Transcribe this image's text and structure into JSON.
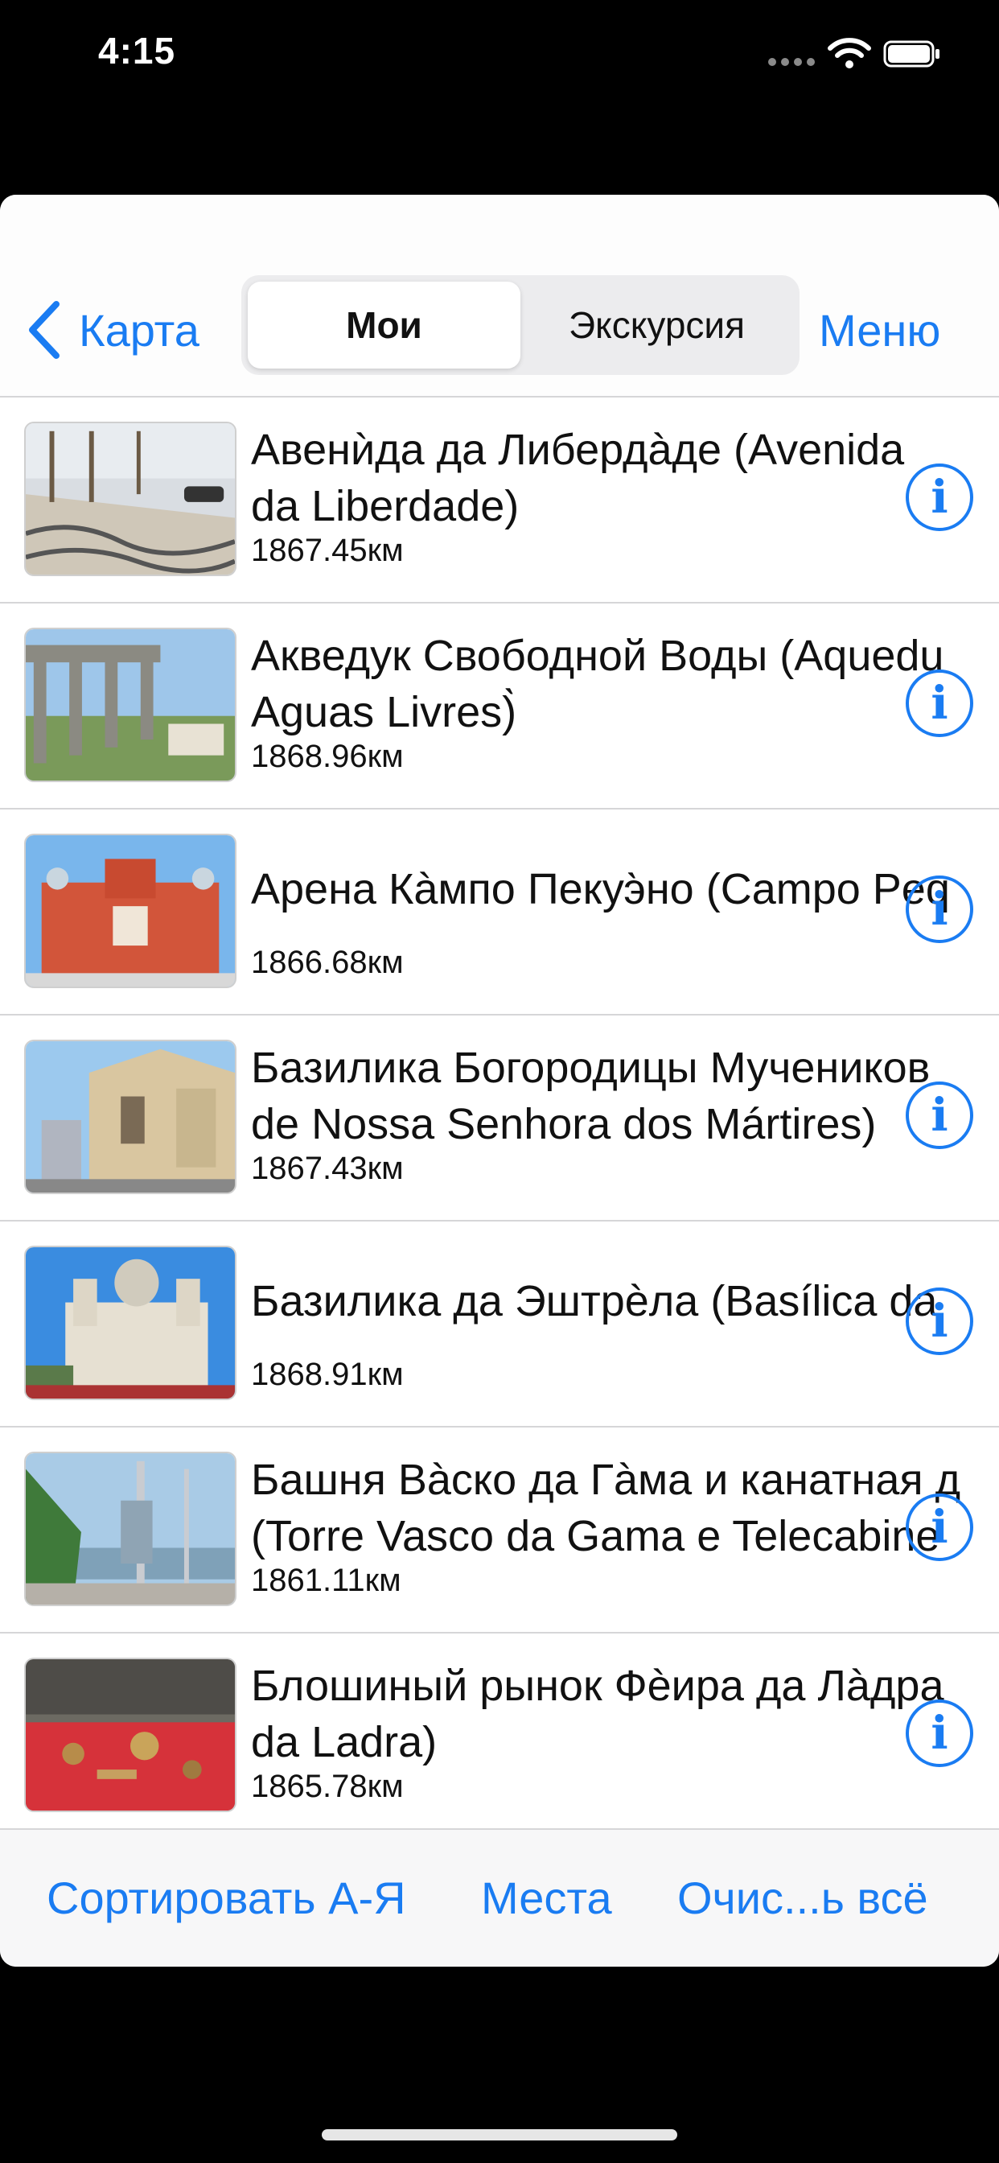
{
  "status_bar": {
    "time": "4:15"
  },
  "nav": {
    "back_label": "Карта",
    "segments": [
      {
        "label": "Мои",
        "selected": true
      },
      {
        "label": "Экскурсия",
        "selected": false
      }
    ],
    "menu_label": "Меню"
  },
  "places": [
    {
      "title_line1": "Авенѝда да Либердàде (Avenida",
      "title_line2": "da Liberdade)",
      "distance": "1867.45км"
    },
    {
      "title_line1": "Акведук Свободной Воды (Aquedu",
      "title_line2": "Aguas Livres)̀",
      "distance": "1868.96км"
    },
    {
      "title_line1": "Арена Кàмпо Пекуэ̀но (Campo Peq",
      "title_line2": "",
      "distance": "1866.68км"
    },
    {
      "title_line1": "Базилика Богородицы Мучеников",
      "title_line2": "de Nossa Senhora dos Mártires)",
      "distance": "1867.43км"
    },
    {
      "title_line1": "Базилика да Эштрѐла (Basílica da",
      "title_line2": "",
      "distance": "1868.91км"
    },
    {
      "title_line1": "Башня Вàско да Гàма и канатная д",
      "title_line2": "(Torre Vasco da Gama e Telecabine",
      "distance": "1861.11км"
    },
    {
      "title_line1": "Блошиный рынок Фѐира да Лàдра",
      "title_line2": "da Ladra)",
      "distance": "1865.78км"
    }
  ],
  "toolbar": {
    "sort_label": "Сортировать А-Я",
    "places_label": "Места",
    "clear_label": "Очис...ь всё"
  },
  "colors": {
    "accent": "#1a7cf2",
    "separator": "#d6d6d8"
  },
  "icons": {
    "back": "chevron-left-icon",
    "info": "info-circle-icon"
  }
}
